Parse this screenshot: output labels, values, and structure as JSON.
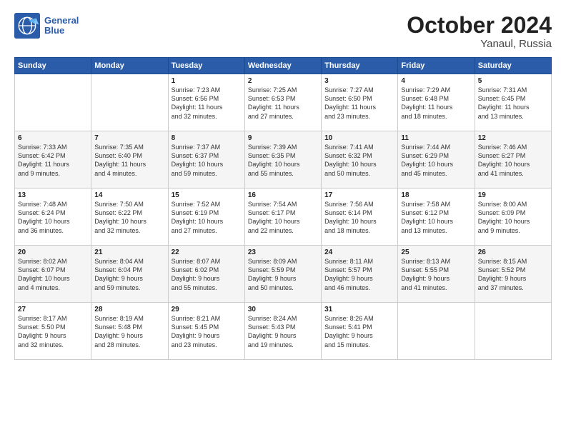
{
  "header": {
    "logo_line1": "General",
    "logo_line2": "Blue",
    "title": "October 2024",
    "subtitle": "Yanaul, Russia"
  },
  "weekdays": [
    "Sunday",
    "Monday",
    "Tuesday",
    "Wednesday",
    "Thursday",
    "Friday",
    "Saturday"
  ],
  "weeks": [
    [
      {
        "day": "",
        "info": ""
      },
      {
        "day": "",
        "info": ""
      },
      {
        "day": "1",
        "info": "Sunrise: 7:23 AM\nSunset: 6:56 PM\nDaylight: 11 hours\nand 32 minutes."
      },
      {
        "day": "2",
        "info": "Sunrise: 7:25 AM\nSunset: 6:53 PM\nDaylight: 11 hours\nand 27 minutes."
      },
      {
        "day": "3",
        "info": "Sunrise: 7:27 AM\nSunset: 6:50 PM\nDaylight: 11 hours\nand 23 minutes."
      },
      {
        "day": "4",
        "info": "Sunrise: 7:29 AM\nSunset: 6:48 PM\nDaylight: 11 hours\nand 18 minutes."
      },
      {
        "day": "5",
        "info": "Sunrise: 7:31 AM\nSunset: 6:45 PM\nDaylight: 11 hours\nand 13 minutes."
      }
    ],
    [
      {
        "day": "6",
        "info": "Sunrise: 7:33 AM\nSunset: 6:42 PM\nDaylight: 11 hours\nand 9 minutes."
      },
      {
        "day": "7",
        "info": "Sunrise: 7:35 AM\nSunset: 6:40 PM\nDaylight: 11 hours\nand 4 minutes."
      },
      {
        "day": "8",
        "info": "Sunrise: 7:37 AM\nSunset: 6:37 PM\nDaylight: 10 hours\nand 59 minutes."
      },
      {
        "day": "9",
        "info": "Sunrise: 7:39 AM\nSunset: 6:35 PM\nDaylight: 10 hours\nand 55 minutes."
      },
      {
        "day": "10",
        "info": "Sunrise: 7:41 AM\nSunset: 6:32 PM\nDaylight: 10 hours\nand 50 minutes."
      },
      {
        "day": "11",
        "info": "Sunrise: 7:44 AM\nSunset: 6:29 PM\nDaylight: 10 hours\nand 45 minutes."
      },
      {
        "day": "12",
        "info": "Sunrise: 7:46 AM\nSunset: 6:27 PM\nDaylight: 10 hours\nand 41 minutes."
      }
    ],
    [
      {
        "day": "13",
        "info": "Sunrise: 7:48 AM\nSunset: 6:24 PM\nDaylight: 10 hours\nand 36 minutes."
      },
      {
        "day": "14",
        "info": "Sunrise: 7:50 AM\nSunset: 6:22 PM\nDaylight: 10 hours\nand 32 minutes."
      },
      {
        "day": "15",
        "info": "Sunrise: 7:52 AM\nSunset: 6:19 PM\nDaylight: 10 hours\nand 27 minutes."
      },
      {
        "day": "16",
        "info": "Sunrise: 7:54 AM\nSunset: 6:17 PM\nDaylight: 10 hours\nand 22 minutes."
      },
      {
        "day": "17",
        "info": "Sunrise: 7:56 AM\nSunset: 6:14 PM\nDaylight: 10 hours\nand 18 minutes."
      },
      {
        "day": "18",
        "info": "Sunrise: 7:58 AM\nSunset: 6:12 PM\nDaylight: 10 hours\nand 13 minutes."
      },
      {
        "day": "19",
        "info": "Sunrise: 8:00 AM\nSunset: 6:09 PM\nDaylight: 10 hours\nand 9 minutes."
      }
    ],
    [
      {
        "day": "20",
        "info": "Sunrise: 8:02 AM\nSunset: 6:07 PM\nDaylight: 10 hours\nand 4 minutes."
      },
      {
        "day": "21",
        "info": "Sunrise: 8:04 AM\nSunset: 6:04 PM\nDaylight: 9 hours\nand 59 minutes."
      },
      {
        "day": "22",
        "info": "Sunrise: 8:07 AM\nSunset: 6:02 PM\nDaylight: 9 hours\nand 55 minutes."
      },
      {
        "day": "23",
        "info": "Sunrise: 8:09 AM\nSunset: 5:59 PM\nDaylight: 9 hours\nand 50 minutes."
      },
      {
        "day": "24",
        "info": "Sunrise: 8:11 AM\nSunset: 5:57 PM\nDaylight: 9 hours\nand 46 minutes."
      },
      {
        "day": "25",
        "info": "Sunrise: 8:13 AM\nSunset: 5:55 PM\nDaylight: 9 hours\nand 41 minutes."
      },
      {
        "day": "26",
        "info": "Sunrise: 8:15 AM\nSunset: 5:52 PM\nDaylight: 9 hours\nand 37 minutes."
      }
    ],
    [
      {
        "day": "27",
        "info": "Sunrise: 8:17 AM\nSunset: 5:50 PM\nDaylight: 9 hours\nand 32 minutes."
      },
      {
        "day": "28",
        "info": "Sunrise: 8:19 AM\nSunset: 5:48 PM\nDaylight: 9 hours\nand 28 minutes."
      },
      {
        "day": "29",
        "info": "Sunrise: 8:21 AM\nSunset: 5:45 PM\nDaylight: 9 hours\nand 23 minutes."
      },
      {
        "day": "30",
        "info": "Sunrise: 8:24 AM\nSunset: 5:43 PM\nDaylight: 9 hours\nand 19 minutes."
      },
      {
        "day": "31",
        "info": "Sunrise: 8:26 AM\nSunset: 5:41 PM\nDaylight: 9 hours\nand 15 minutes."
      },
      {
        "day": "",
        "info": ""
      },
      {
        "day": "",
        "info": ""
      }
    ]
  ]
}
